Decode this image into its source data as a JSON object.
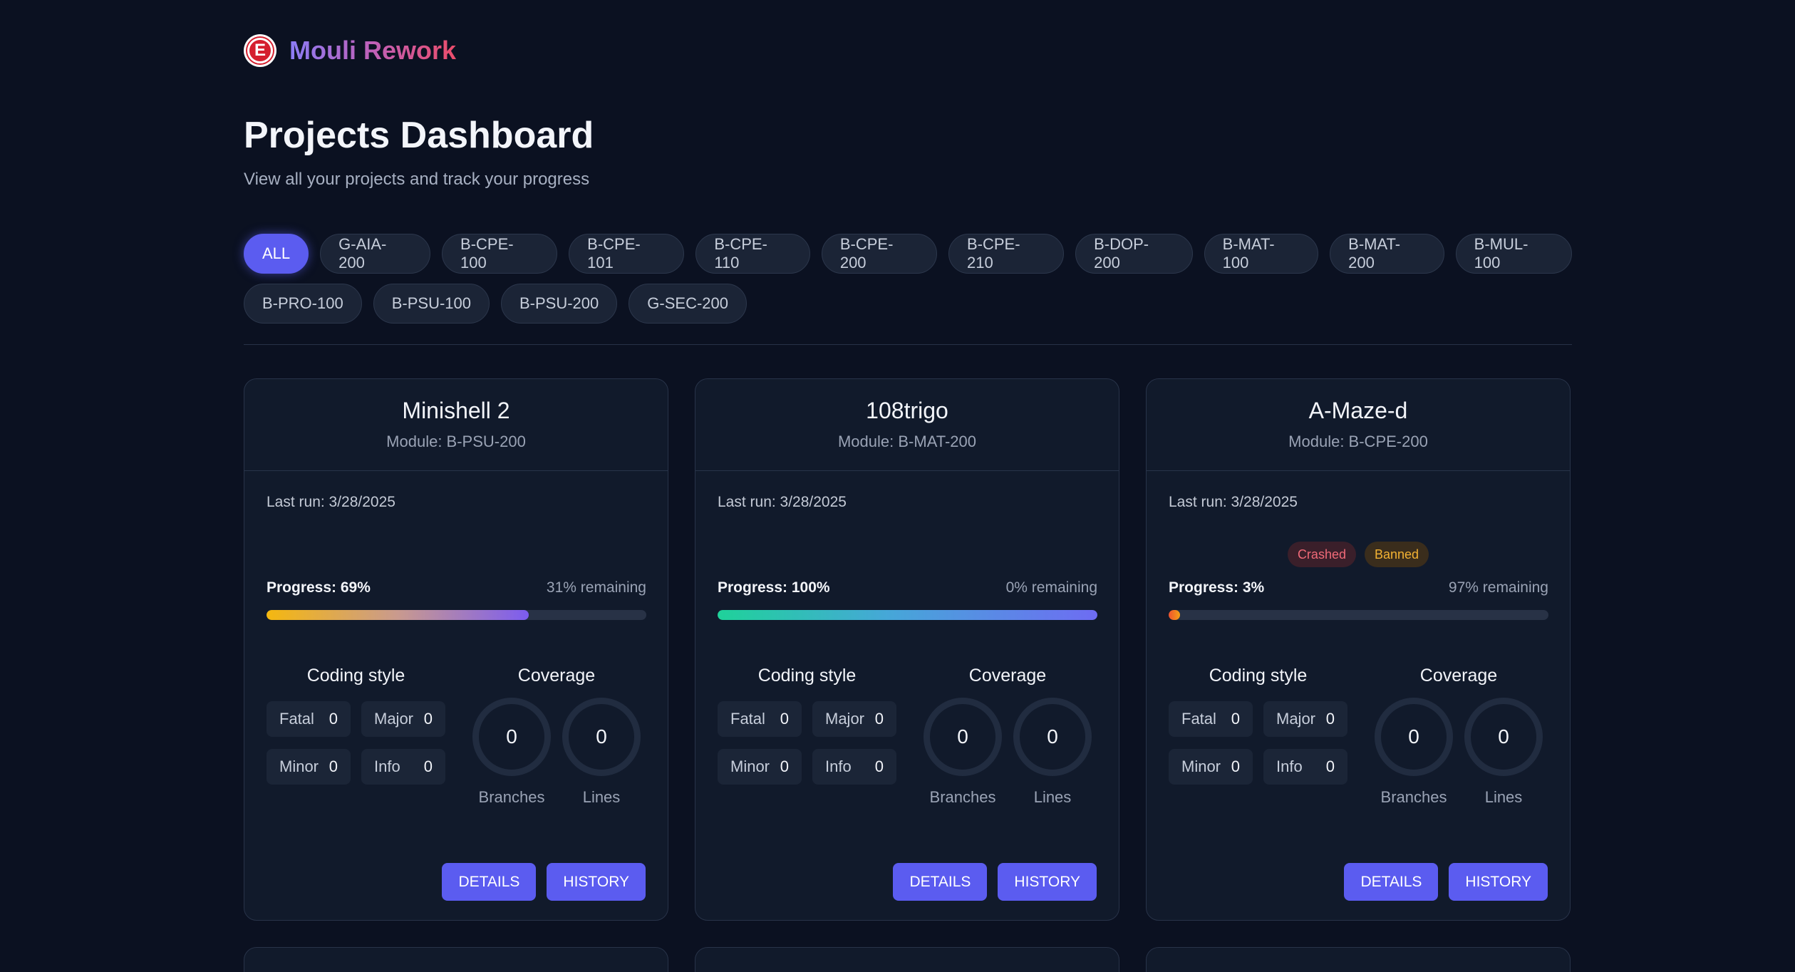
{
  "brand": {
    "name": "Mouli Rework",
    "logo_letter": "E"
  },
  "header": {
    "title": "Projects Dashboard",
    "subtitle": "View all your projects and track your progress"
  },
  "filters": {
    "active": "ALL",
    "row1": [
      "ALL",
      "G-AIA-200",
      "B-CPE-100",
      "B-CPE-101",
      "B-CPE-110",
      "B-CPE-200",
      "B-CPE-210",
      "B-DOP-200",
      "B-MAT-100",
      "B-MAT-200",
      "B-MUL-100"
    ],
    "row2": [
      "B-PRO-100",
      "B-PSU-100",
      "B-PSU-200",
      "G-SEC-200"
    ]
  },
  "colors": {
    "accent": "#5b5cf0",
    "background": "#0b1121",
    "card": "#111a2b",
    "crashed": "#f06a78",
    "banned": "#f2b233"
  },
  "projects": [
    {
      "title": "Minishell 2",
      "module": "Module: B-PSU-200",
      "last_run": "Last run: 3/28/2025",
      "tags": [],
      "progress_value": 69,
      "progress_label": "Progress: 69%",
      "remaining": "31% remaining",
      "progress_gradient": "linear-gradient(90deg, #f5b80f 0%, #c99a8e 50%, #7c5cf0 100%)",
      "coding_style_title": "Coding style",
      "coverage_title": "Coverage",
      "coding_style": {
        "fatal_label": "Fatal",
        "fatal": "0",
        "major_label": "Major",
        "major": "0",
        "minor_label": "Minor",
        "minor": "0",
        "info_label": "Info",
        "info": "0"
      },
      "coverage": {
        "branches": "0",
        "branches_label": "Branches",
        "lines": "0",
        "lines_label": "Lines"
      },
      "details_label": "DETAILS",
      "history_label": "HISTORY"
    },
    {
      "title": "108trigo",
      "module": "Module: B-MAT-200",
      "last_run": "Last run: 3/28/2025",
      "tags": [],
      "progress_value": 100,
      "progress_label": "Progress: 100%",
      "remaining": "0% remaining",
      "progress_gradient": "linear-gradient(90deg, #1fd29a 0%, #46a7d8 45%, #6e6cf3 100%)",
      "coding_style_title": "Coding style",
      "coverage_title": "Coverage",
      "coding_style": {
        "fatal_label": "Fatal",
        "fatal": "0",
        "major_label": "Major",
        "major": "0",
        "minor_label": "Minor",
        "minor": "0",
        "info_label": "Info",
        "info": "0"
      },
      "coverage": {
        "branches": "0",
        "branches_label": "Branches",
        "lines": "0",
        "lines_label": "Lines"
      },
      "details_label": "DETAILS",
      "history_label": "HISTORY"
    },
    {
      "title": "A-Maze-d",
      "module": "Module: B-CPE-200",
      "last_run": "Last run: 3/28/2025",
      "tags": [
        {
          "label": "Crashed",
          "kind": "crashed"
        },
        {
          "label": "Banned",
          "kind": "banned"
        }
      ],
      "progress_value": 3,
      "progress_label": "Progress: 3%",
      "remaining": "97% remaining",
      "progress_gradient": "linear-gradient(90deg, #f0522f 0%, #f5a015 100%)",
      "coding_style_title": "Coding style",
      "coverage_title": "Coverage",
      "coding_style": {
        "fatal_label": "Fatal",
        "fatal": "0",
        "major_label": "Major",
        "major": "0",
        "minor_label": "Minor",
        "minor": "0",
        "info_label": "Info",
        "info": "0"
      },
      "coverage": {
        "branches": "0",
        "branches_label": "Branches",
        "lines": "0",
        "lines_label": "Lines"
      },
      "details_label": "DETAILS",
      "history_label": "HISTORY"
    }
  ]
}
